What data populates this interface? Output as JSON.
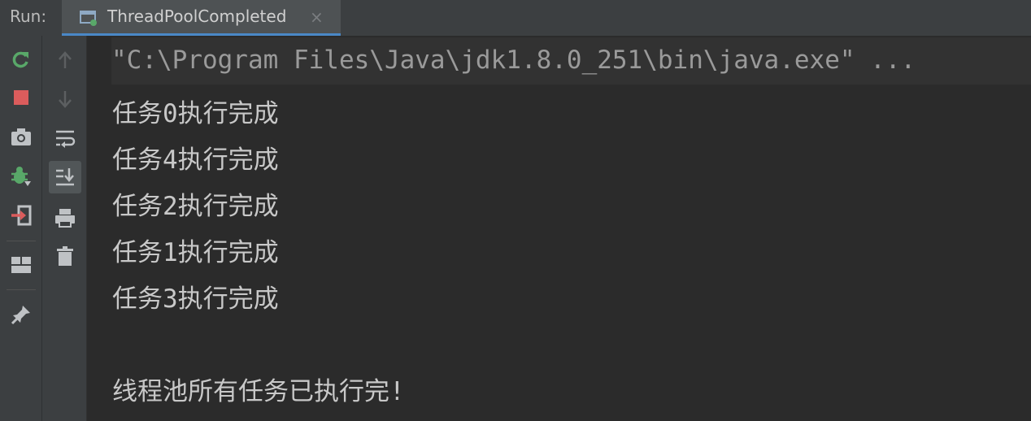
{
  "header": {
    "run_label": "Run:",
    "tab_title": "ThreadPoolCompleted",
    "close_glyph": "×"
  },
  "toolbar_primary": [
    {
      "name": "rerun-icon",
      "label": "Rerun",
      "color": "#59a869"
    },
    {
      "name": "stop-icon",
      "label": "Stop",
      "color": "#db5c5c"
    },
    {
      "name": "camera-icon",
      "label": "Dump Threads"
    },
    {
      "name": "debug-rerun-icon",
      "label": "Rerun Debug",
      "color": "#59a869"
    },
    {
      "name": "exit-icon",
      "label": "Exit",
      "color": "#db5c5c"
    },
    {
      "name": "layout-icon",
      "label": "Restore Layout"
    },
    {
      "name": "pin-icon",
      "label": "Pin Tab"
    }
  ],
  "toolbar_secondary": [
    {
      "name": "arrow-up-icon",
      "label": "Up the Stack Trace"
    },
    {
      "name": "arrow-down-icon",
      "label": "Down the Stack Trace"
    },
    {
      "name": "soft-wrap-icon",
      "label": "Soft-Wrap"
    },
    {
      "name": "scroll-to-end-icon",
      "label": "Scroll to the End"
    },
    {
      "name": "print-icon",
      "label": "Print"
    },
    {
      "name": "trash-icon",
      "label": "Clear All"
    }
  ],
  "console": {
    "command": "\"C:\\Program Files\\Java\\jdk1.8.0_251\\bin\\java.exe\" ...",
    "lines": [
      "任务0执行完成",
      "任务4执行完成",
      "任务2执行完成",
      "任务1执行完成",
      "任务3执行完成",
      "",
      "线程池所有任务已执行完!"
    ]
  },
  "colors": {
    "background": "#2b2b2b",
    "panel": "#3c3f41",
    "tab_active": "#4e5254",
    "accent": "#4a88c7",
    "text": "#c8c8c8"
  }
}
